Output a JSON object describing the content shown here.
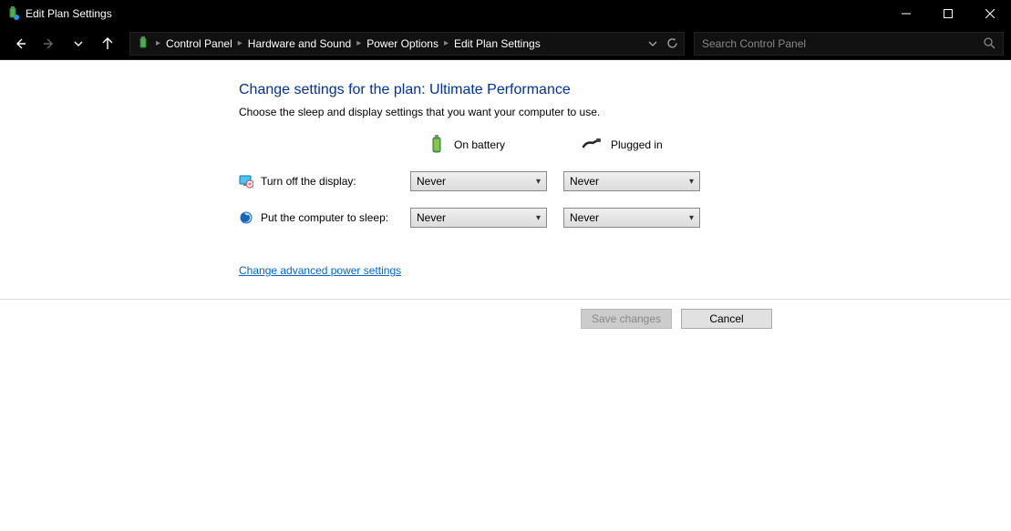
{
  "window": {
    "title": "Edit Plan Settings"
  },
  "breadcrumbs": {
    "items": [
      "Control Panel",
      "Hardware and Sound",
      "Power Options",
      "Edit Plan Settings"
    ]
  },
  "search": {
    "placeholder": "Search Control Panel"
  },
  "page": {
    "heading": "Change settings for the plan: Ultimate Performance",
    "subtitle": "Choose the sleep and display settings that you want your computer to use."
  },
  "columns": {
    "battery": "On battery",
    "plugged": "Plugged in"
  },
  "rows": {
    "display": {
      "label": "Turn off the display:",
      "battery": "Never",
      "plugged": "Never"
    },
    "sleep": {
      "label": "Put the computer to sleep:",
      "battery": "Never",
      "plugged": "Never"
    }
  },
  "links": {
    "advanced": "Change advanced power settings"
  },
  "buttons": {
    "save": "Save changes",
    "cancel": "Cancel"
  }
}
